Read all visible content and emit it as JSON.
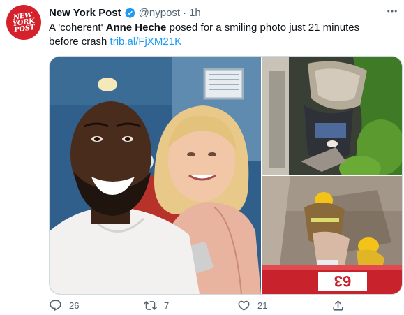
{
  "account": {
    "name": "New York Post",
    "handle": "@nypost",
    "separator": "·",
    "time": "1h",
    "avatar_text": "NEW\nYORK\nPOST",
    "brand_color": "#d4212b",
    "verified_color": "#1d9bf0"
  },
  "tweet": {
    "text_part1": "A 'coherent' ",
    "text_bold": "Anne Heche",
    "text_part2": " posed for a smiling photo just 21 minutes before crash ",
    "link": "trib.al/FjXM21K",
    "link_color": "#1d9bf0"
  },
  "media": {
    "photo3_truck_number": "63"
  },
  "actions": {
    "reply_count": "26",
    "retweet_count": "7",
    "like_count": "21"
  },
  "icons": [
    "verified-badge-icon",
    "more-options-icon",
    "reply-icon",
    "retweet-icon",
    "like-icon",
    "share-icon"
  ]
}
